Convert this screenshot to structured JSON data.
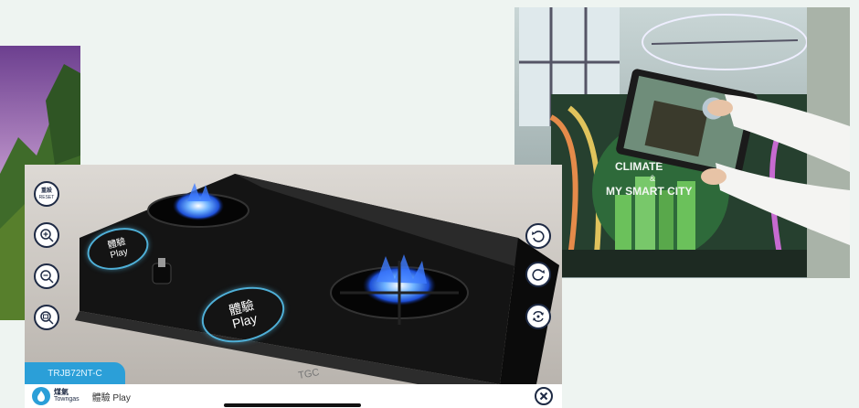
{
  "colors": {
    "accent_blue": "#2b9fd8",
    "ring_blue": "#4fb0d8",
    "control_border": "#1e2a44",
    "page_background": "#eef4f1"
  },
  "app": {
    "controls_left": [
      {
        "icon": "reset-icon",
        "label_cn": "重設",
        "label_en": "RESET"
      },
      {
        "icon": "zoom-in-icon"
      },
      {
        "icon": "zoom-out-icon"
      },
      {
        "icon": "fit-view-icon"
      }
    ],
    "controls_right": [
      {
        "icon": "rotate-left-icon"
      },
      {
        "icon": "rotate-right-icon"
      },
      {
        "icon": "rotate-360-icon"
      }
    ],
    "play_rings": [
      {
        "label_cn": "體驗",
        "label_en": "Play"
      },
      {
        "label_cn": "體驗",
        "label_en": "Play"
      }
    ],
    "stove_brand": "TGC",
    "model_tab": "TRJB72NT-C",
    "footer": {
      "brand_cn": "煤氣",
      "brand_en": "Towngas",
      "title": "體驗 Play",
      "close_icon": "close-icon"
    }
  },
  "right_photo": {
    "sign_line1": "CLIMATE",
    "sign_amp": "&",
    "sign_line2": "MY SMART CITY"
  }
}
